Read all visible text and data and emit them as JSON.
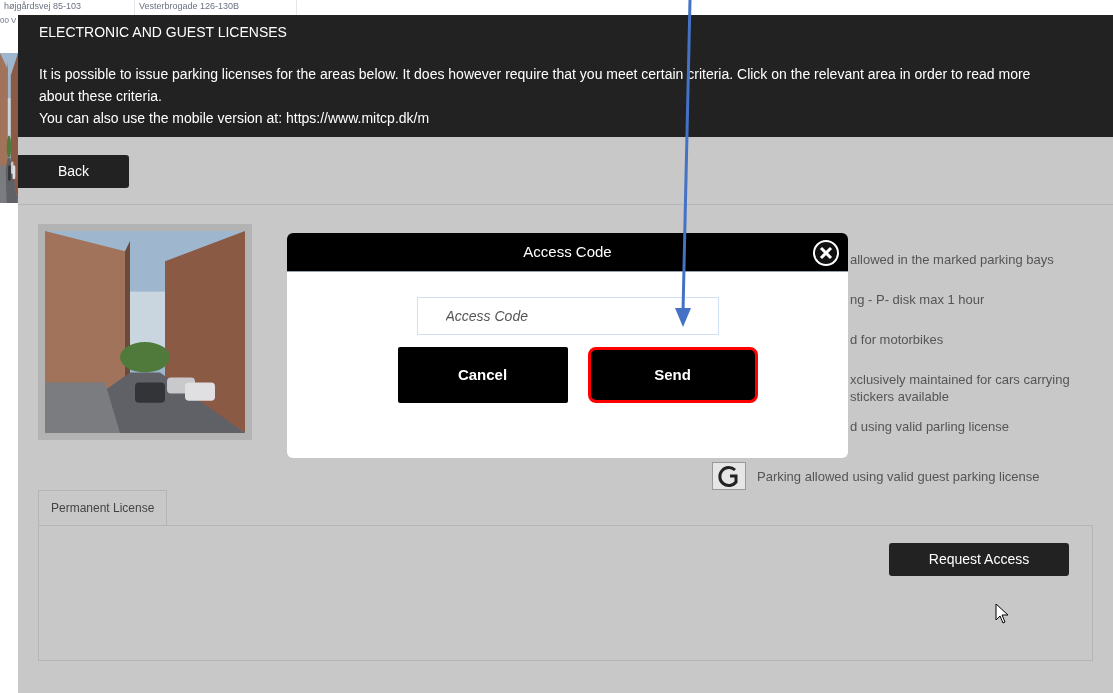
{
  "background_cards": [
    {
      "address": "højgårdsvej 85-103",
      "suffix": "00 V"
    },
    {
      "address": "Vesterbrogade 126-130B"
    }
  ],
  "header": {
    "title": "ELECTRONIC AND GUEST LICENSES",
    "paragraphs": [
      "It is possible to issue parking licenses for the areas below. It does however require that you meet certain criteria. Click on the relevant area in order to read more about these criteria.",
      "You can also use the mobile version at: https://www.mitcp.dk/m"
    ]
  },
  "back_button": "Back",
  "area": {
    "legend": [
      {
        "kind": "partial",
        "lines": [
          "allowed in the marked parking bays"
        ]
      },
      {
        "kind": "partial",
        "lines": [
          "ng - P- disk max 1 hour"
        ]
      },
      {
        "kind": "partial",
        "lines": [
          "d for motorbikes"
        ]
      },
      {
        "kind": "partial",
        "lines": [
          "xclusively maintained for cars carrying",
          "stickers available"
        ]
      },
      {
        "kind": "partial",
        "lines": [
          "d using valid parling license"
        ]
      },
      {
        "kind": "guest",
        "lines": [
          "Parking allowed using valid guest parking license"
        ]
      }
    ]
  },
  "tabs": [
    {
      "label": "Permanent License",
      "selected": true
    }
  ],
  "request_button": "Request Access",
  "dialog": {
    "title": "Access Code",
    "field": {
      "placeholder": "Access Code"
    },
    "buttons": [
      {
        "label": "Cancel",
        "highlighted": false
      },
      {
        "label": "Send",
        "highlighted": true
      }
    ]
  }
}
